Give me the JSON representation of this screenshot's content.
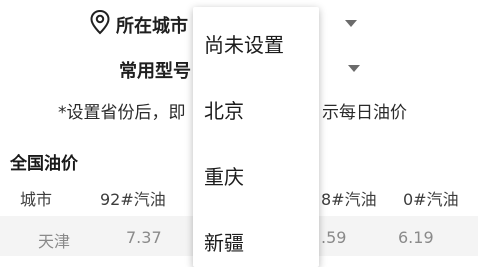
{
  "header": {
    "city_label": "所在城市",
    "model_label": "常用型号",
    "location_icon": "location-pin-icon"
  },
  "notice": {
    "left_text": "*设置省份后，即",
    "right_text": "示每日油价"
  },
  "section": {
    "title": "全国油价"
  },
  "table": {
    "headers": {
      "city": "城市",
      "col92": "92#汽油",
      "col98_partial": "8#汽油",
      "col0": "0#汽油"
    },
    "rows": [
      {
        "city": "天津",
        "col92": "7.37",
        "col98_partial": ".59",
        "col0": "6.19"
      }
    ]
  },
  "dropdown": {
    "options": [
      "尚未设置",
      "北京",
      "重庆",
      "新疆"
    ]
  }
}
